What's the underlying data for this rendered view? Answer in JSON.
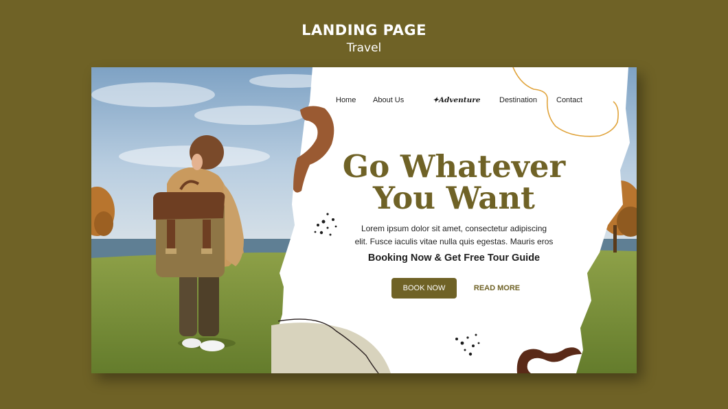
{
  "header": {
    "title": "LANDING PAGE",
    "subtitle": "Travel"
  },
  "nav": {
    "home": "Home",
    "about": "About Us",
    "logo": "Adventure",
    "destination": "Destination",
    "contact": "Contact"
  },
  "hero": {
    "title_line1": "Go Whatever",
    "title_line2": "You Want",
    "desc_line1": "Lorem ipsum dolor sit amet, consectetur adipiscing",
    "desc_line2": "elit. Fusce iaculis vitae nulla quis egestas. Mauris eros",
    "subheadline": "Booking Now & Get Free Tour Guide",
    "book_button": "BOOK NOW",
    "read_more": "READ MORE"
  },
  "colors": {
    "background": "#6f6226",
    "accent": "#6f6226",
    "brown_shape": "#9a5a32",
    "dark_brown": "#5a2a18",
    "orange_line": "#e0a33a",
    "beige_blob": "#d8d3bd"
  }
}
